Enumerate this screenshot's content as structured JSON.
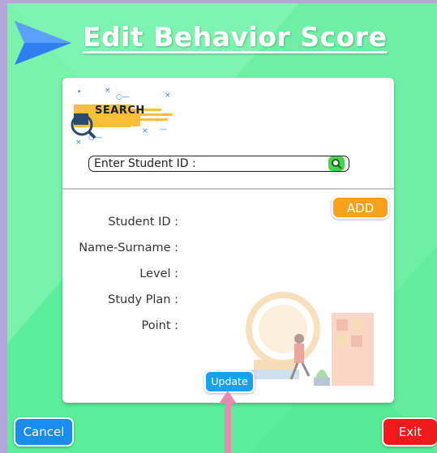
{
  "header": {
    "title": "Edit Behavior Score"
  },
  "search": {
    "logo_text": "SEARCH",
    "placeholder": "Enter Student ID :"
  },
  "form": {
    "add_label": "ADD",
    "fields": [
      {
        "label": "Student ID :"
      },
      {
        "label": "Name-Surname :"
      },
      {
        "label": "Level :"
      },
      {
        "label": "Study Plan :"
      },
      {
        "label": "Point :"
      }
    ],
    "update_label": "Update"
  },
  "footer": {
    "cancel_label": "Cancel",
    "exit_label": "Exit"
  },
  "colors": {
    "background": "#5dee9c",
    "add": "#f7a21b",
    "update": "#1ba0f0",
    "cancel": "#1a8cf0",
    "exit": "#f01a1a"
  }
}
